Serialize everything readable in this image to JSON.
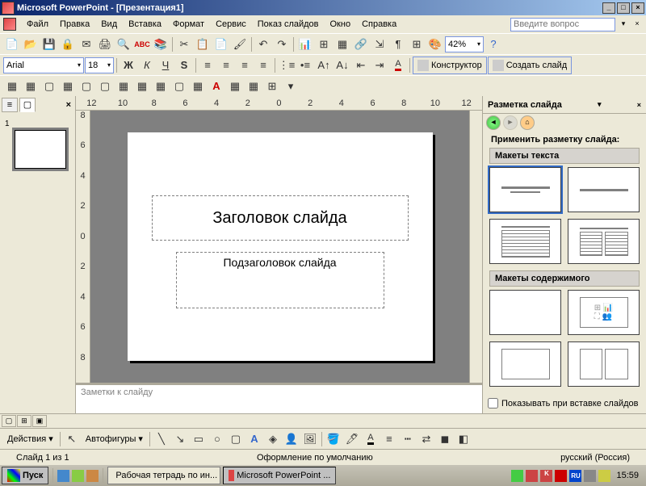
{
  "titlebar": {
    "app": "Microsoft PowerPoint",
    "doc": "[Презентация1]"
  },
  "menubar": {
    "items": [
      "Файл",
      "Правка",
      "Вид",
      "Вставка",
      "Формат",
      "Сервис",
      "Показ слайдов",
      "Окно",
      "Справка"
    ],
    "help_placeholder": "Введите вопрос"
  },
  "formatting": {
    "font": "Arial",
    "size": "18",
    "zoom": "42%"
  },
  "design": {
    "constructor": "Конструктор",
    "new_slide": "Создать слайд"
  },
  "thumb": {
    "num": "1"
  },
  "ruler_h": [
    "12",
    "10",
    "8",
    "6",
    "4",
    "2",
    "0",
    "2",
    "4",
    "6",
    "8",
    "10",
    "12"
  ],
  "ruler_v": [
    "8",
    "6",
    "4",
    "2",
    "0",
    "2",
    "4",
    "6",
    "8"
  ],
  "slide": {
    "title": "Заголовок слайда",
    "subtitle": "Подзаголовок слайда"
  },
  "notes": {
    "placeholder": "Заметки к слайду"
  },
  "taskpane": {
    "title": "Разметка слайда",
    "apply": "Применить разметку слайда:",
    "sec1": "Макеты текста",
    "sec2": "Макеты содержимого",
    "show_on_insert": "Показывать при вставке слайдов"
  },
  "drawbar": {
    "actions": "Действия",
    "autoshapes": "Автофигуры"
  },
  "status": {
    "slide": "Слайд 1 из 1",
    "design": "Оформление по умолчанию",
    "lang": "русский (Россия)"
  },
  "taskbar": {
    "start": "Пуск",
    "items": [
      "Рабочая тетрадь по ин...",
      "Microsoft PowerPoint ..."
    ],
    "lang": "RU",
    "time": "15:59"
  }
}
